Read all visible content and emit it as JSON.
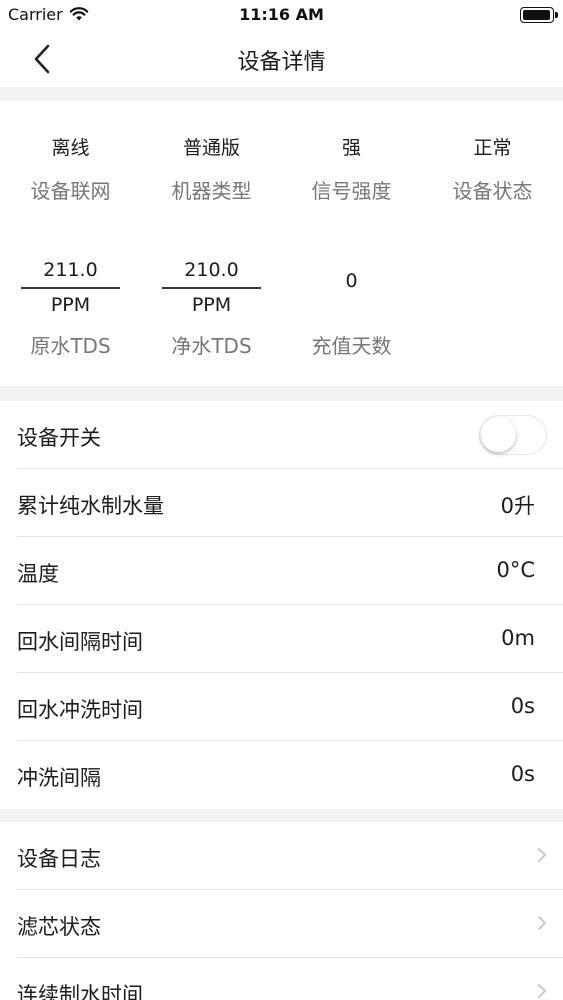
{
  "status_bar": {
    "carrier": "Carrier",
    "time": "11:16 AM"
  },
  "nav": {
    "title": "设备详情"
  },
  "info": {
    "row1": [
      {
        "value": "离线",
        "label": "设备联网"
      },
      {
        "value": "普通版",
        "label": "机器类型"
      },
      {
        "value": "强",
        "label": "信号强度"
      },
      {
        "value": "正常",
        "label": "设备状态"
      }
    ],
    "raw_tds": {
      "value": "211.0",
      "unit": "PPM",
      "label": "原水TDS"
    },
    "pure_tds": {
      "value": "210.0",
      "unit": "PPM",
      "label": "净水TDS"
    },
    "recharge_days": {
      "value": "0",
      "label": "充值天数"
    }
  },
  "settings": {
    "power": {
      "label": "设备开关",
      "on": false
    },
    "rows": [
      {
        "label": "累计纯水制水量",
        "value": "0升"
      },
      {
        "label": "温度",
        "value": "0°C"
      },
      {
        "label": "回水间隔时间",
        "value": "0m"
      },
      {
        "label": "回水冲洗时间",
        "value": "0s"
      },
      {
        "label": "冲洗间隔",
        "value": "0s"
      }
    ]
  },
  "links": [
    {
      "label": "设备日志"
    },
    {
      "label": "滤芯状态"
    },
    {
      "label": "连续制水时间"
    }
  ],
  "colors": {
    "background": "#f3f3f5",
    "card": "#ffffff",
    "label_gray": "#777777",
    "separator": "#e3e3e5"
  }
}
